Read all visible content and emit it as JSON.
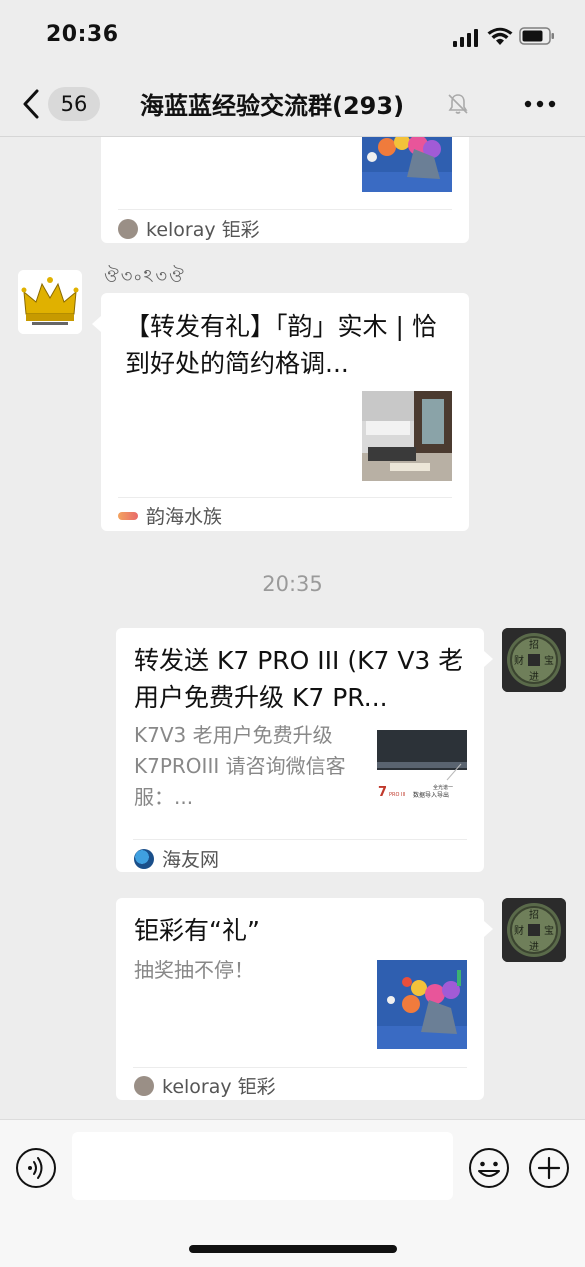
{
  "status_bar": {
    "time": "20:36"
  },
  "nav": {
    "unread_count": "56",
    "title": "海蓝蓝经验交流群(293)"
  },
  "messages": [
    {
      "kind": "link-card-partial",
      "source": "keloray 钜彩"
    },
    {
      "kind": "link-card-incoming",
      "sender": "ঔ৩৹ঽ৩ঔ",
      "title": "【转发有礼】「韵」实木 | 恰到好处的简约格调...",
      "source": "韵海水族"
    },
    {
      "kind": "timestamp",
      "text": "20:35"
    },
    {
      "kind": "link-card-outgoing",
      "title": "转发送 K7 PRO III (K7 V3 老用户免费升级 K7 PR...",
      "desc": "K7V3 老用户免费升级 K7PROIII 请咨询微信客服：...",
      "thumb_text": "7 PRO III 数据导入导出 全光谱一",
      "source": "海友网"
    },
    {
      "kind": "link-card-outgoing",
      "title": "钜彩有“礼”",
      "desc": "抽奖抽不停！",
      "source": "keloray 钜彩"
    }
  ],
  "input": {
    "placeholder": ""
  },
  "colors": {
    "background": "#ededed",
    "bubble": "#ffffff",
    "accent_green": "#07c160"
  },
  "icons": {
    "back": "chevron-left-icon",
    "mute": "bell-slash-icon",
    "more": "more-dots-icon",
    "voice": "voice-icon",
    "emoji": "emoji-icon",
    "plus": "plus-circle-icon"
  }
}
